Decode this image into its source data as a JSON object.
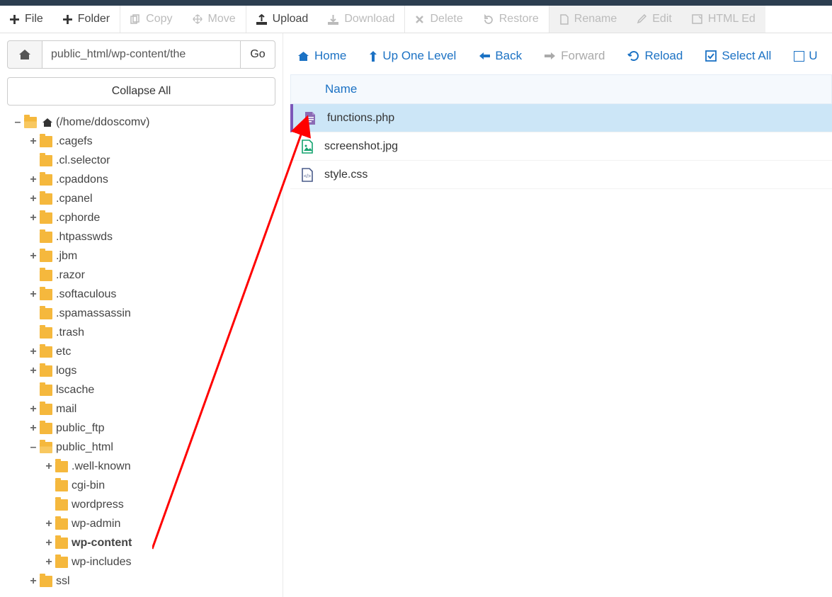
{
  "toolbar": {
    "file": "File",
    "folder": "Folder",
    "copy": "Copy",
    "move": "Move",
    "upload": "Upload",
    "download": "Download",
    "delete": "Delete",
    "restore": "Restore",
    "rename": "Rename",
    "edit": "Edit",
    "htmledit": "HTML Ed"
  },
  "path": {
    "value": "public_html/wp-content/the",
    "go": "Go"
  },
  "sidebar": {
    "collapse_all": "Collapse All",
    "root_label": "(/home/ddoscomv)",
    "tree": [
      {
        "depth": 1,
        "expander": "+",
        "label": ".cagefs"
      },
      {
        "depth": 1,
        "expander": "",
        "label": ".cl.selector"
      },
      {
        "depth": 1,
        "expander": "+",
        "label": ".cpaddons"
      },
      {
        "depth": 1,
        "expander": "+",
        "label": ".cpanel"
      },
      {
        "depth": 1,
        "expander": "+",
        "label": ".cphorde"
      },
      {
        "depth": 1,
        "expander": "",
        "label": ".htpasswds"
      },
      {
        "depth": 1,
        "expander": "+",
        "label": ".jbm"
      },
      {
        "depth": 1,
        "expander": "",
        "label": ".razor"
      },
      {
        "depth": 1,
        "expander": "+",
        "label": ".softaculous"
      },
      {
        "depth": 1,
        "expander": "",
        "label": ".spamassassin"
      },
      {
        "depth": 1,
        "expander": "",
        "label": ".trash"
      },
      {
        "depth": 1,
        "expander": "+",
        "label": "etc"
      },
      {
        "depth": 1,
        "expander": "+",
        "label": "logs"
      },
      {
        "depth": 1,
        "expander": "",
        "label": "lscache"
      },
      {
        "depth": 1,
        "expander": "+",
        "label": "mail"
      },
      {
        "depth": 1,
        "expander": "+",
        "label": "public_ftp"
      },
      {
        "depth": 1,
        "expander": "–",
        "label": "public_html",
        "open": true
      },
      {
        "depth": 2,
        "expander": "+",
        "label": ".well-known"
      },
      {
        "depth": 2,
        "expander": "",
        "label": "cgi-bin"
      },
      {
        "depth": 2,
        "expander": "",
        "label": "wordpress"
      },
      {
        "depth": 2,
        "expander": "+",
        "label": "wp-admin"
      },
      {
        "depth": 2,
        "expander": "+",
        "label": "wp-content",
        "bold": true
      },
      {
        "depth": 2,
        "expander": "+",
        "label": "wp-includes"
      },
      {
        "depth": 1,
        "expander": "+",
        "label": "ssl"
      }
    ]
  },
  "actionbar": {
    "home": "Home",
    "up": "Up One Level",
    "back": "Back",
    "forward": "Forward",
    "reload": "Reload",
    "select_all": "Select All",
    "unselect_partial": "U"
  },
  "list": {
    "col_name": "Name",
    "files": [
      {
        "name": "functions.php",
        "type": "php",
        "selected": true
      },
      {
        "name": "screenshot.jpg",
        "type": "img",
        "selected": false
      },
      {
        "name": "style.css",
        "type": "css",
        "selected": false
      }
    ]
  }
}
